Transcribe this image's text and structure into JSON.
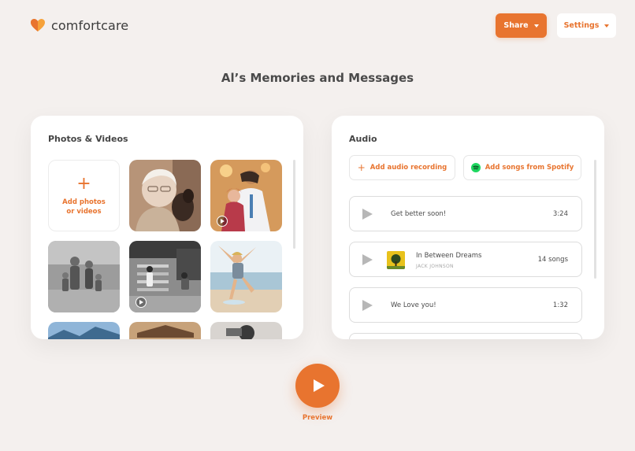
{
  "app": {
    "logo_text": "comfortcare",
    "logo_icon": "heart-icon",
    "brand_color": "#e8742f"
  },
  "header": {
    "share_label": "Share",
    "settings_label": "Settings"
  },
  "page": {
    "title": "Al’s Memories and Messages"
  },
  "photos": {
    "title": "Photos & Videos",
    "add_line1": "Add photos",
    "add_line2": "or videos",
    "items": [
      {
        "kind": "photo",
        "video": false
      },
      {
        "kind": "photo",
        "video": true
      },
      {
        "kind": "photo",
        "video": false
      },
      {
        "kind": "photo",
        "video": true
      },
      {
        "kind": "photo",
        "video": false
      },
      {
        "kind": "photo",
        "video": false
      },
      {
        "kind": "photo",
        "video": false
      },
      {
        "kind": "photo",
        "video": false
      }
    ]
  },
  "audio": {
    "title": "Audio",
    "add_recording_label": "Add audio recording",
    "add_spotify_label": "Add songs from Spotify",
    "tracks": [
      {
        "title": "Get better soon!",
        "meta": "3:24"
      },
      {
        "title": "In Between Dreams",
        "artist": "JACK JOHNSON",
        "meta": "14 songs"
      },
      {
        "title": "We Love you!",
        "meta": "1:32"
      }
    ]
  },
  "preview": {
    "label": "Preview"
  }
}
